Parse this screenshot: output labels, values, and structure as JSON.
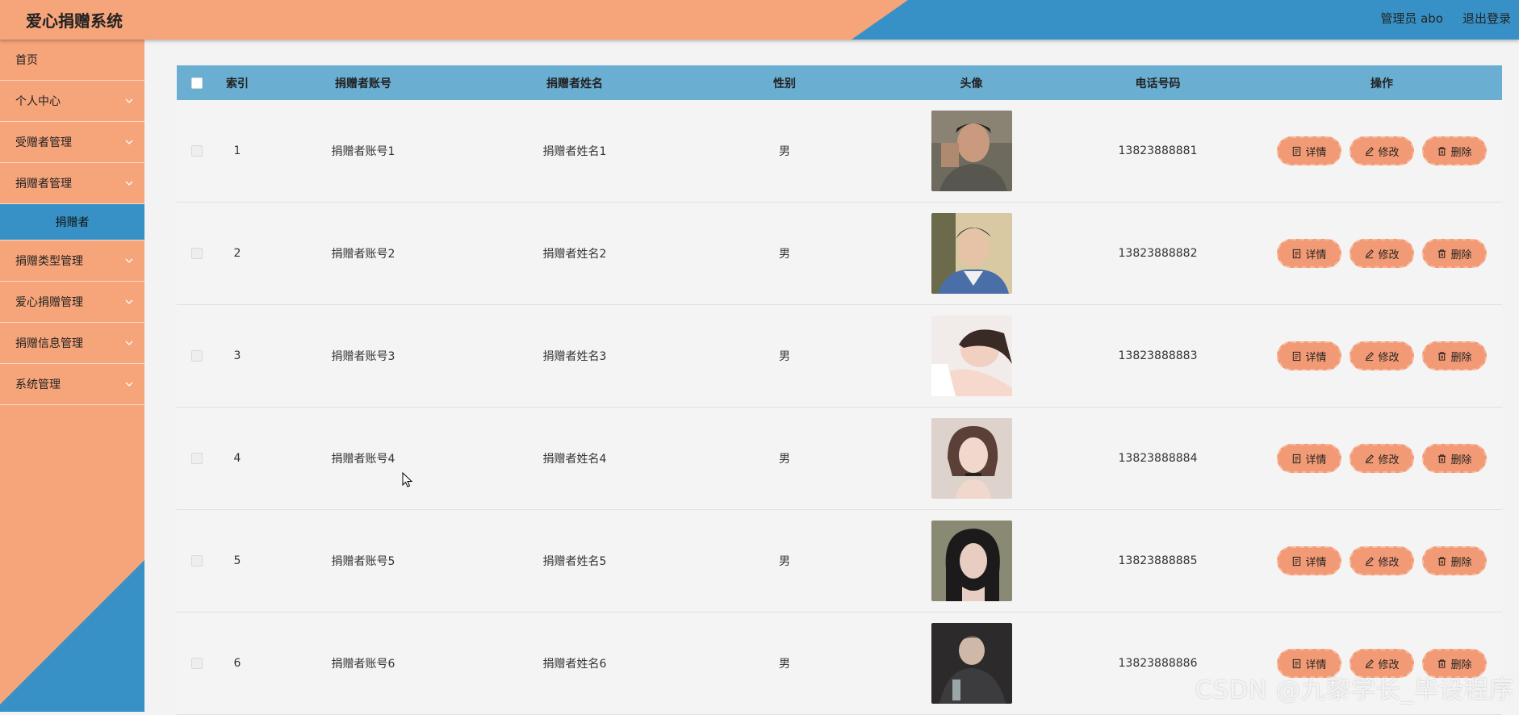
{
  "header": {
    "title": "爱心捐赠系统",
    "user": "管理员 abo",
    "logout": "退出登录",
    "colors": {
      "left": "#f6a47a",
      "right": "#3891c6"
    }
  },
  "sidebar": {
    "items": [
      {
        "label": "首页",
        "has_children": false
      },
      {
        "label": "个人中心",
        "has_children": true
      },
      {
        "label": "受赠者管理",
        "has_children": true
      },
      {
        "label": "捐赠者管理",
        "has_children": true,
        "expanded": true,
        "children": [
          {
            "label": "捐赠者",
            "active": true
          }
        ]
      },
      {
        "label": "捐赠类型管理",
        "has_children": true
      },
      {
        "label": "爱心捐赠管理",
        "has_children": true
      },
      {
        "label": "捐赠信息管理",
        "has_children": true
      },
      {
        "label": "系统管理",
        "has_children": true
      }
    ]
  },
  "table": {
    "columns": [
      "索引",
      "捐赠者账号",
      "捐赠者姓名",
      "性别",
      "头像",
      "电话号码",
      "操作"
    ],
    "rows": [
      {
        "index": "1",
        "account": "捐赠者账号1",
        "name": "捐赠者姓名1",
        "gender": "男",
        "avatar": "avatar-1",
        "phone": "13823888881"
      },
      {
        "index": "2",
        "account": "捐赠者账号2",
        "name": "捐赠者姓名2",
        "gender": "男",
        "avatar": "avatar-2",
        "phone": "13823888882"
      },
      {
        "index": "3",
        "account": "捐赠者账号3",
        "name": "捐赠者姓名3",
        "gender": "男",
        "avatar": "avatar-3",
        "phone": "13823888883"
      },
      {
        "index": "4",
        "account": "捐赠者账号4",
        "name": "捐赠者姓名4",
        "gender": "男",
        "avatar": "avatar-4",
        "phone": "13823888884"
      },
      {
        "index": "5",
        "account": "捐赠者账号5",
        "name": "捐赠者姓名5",
        "gender": "男",
        "avatar": "avatar-5",
        "phone": "13823888885"
      },
      {
        "index": "6",
        "account": "捐赠者账号6",
        "name": "捐赠者姓名6",
        "gender": "男",
        "avatar": "avatar-6",
        "phone": "13823888886"
      }
    ],
    "actions": {
      "detail": "详情",
      "edit": "修改",
      "delete": "删除"
    }
  },
  "watermark": "CSDN @九黎学长_毕设程序"
}
